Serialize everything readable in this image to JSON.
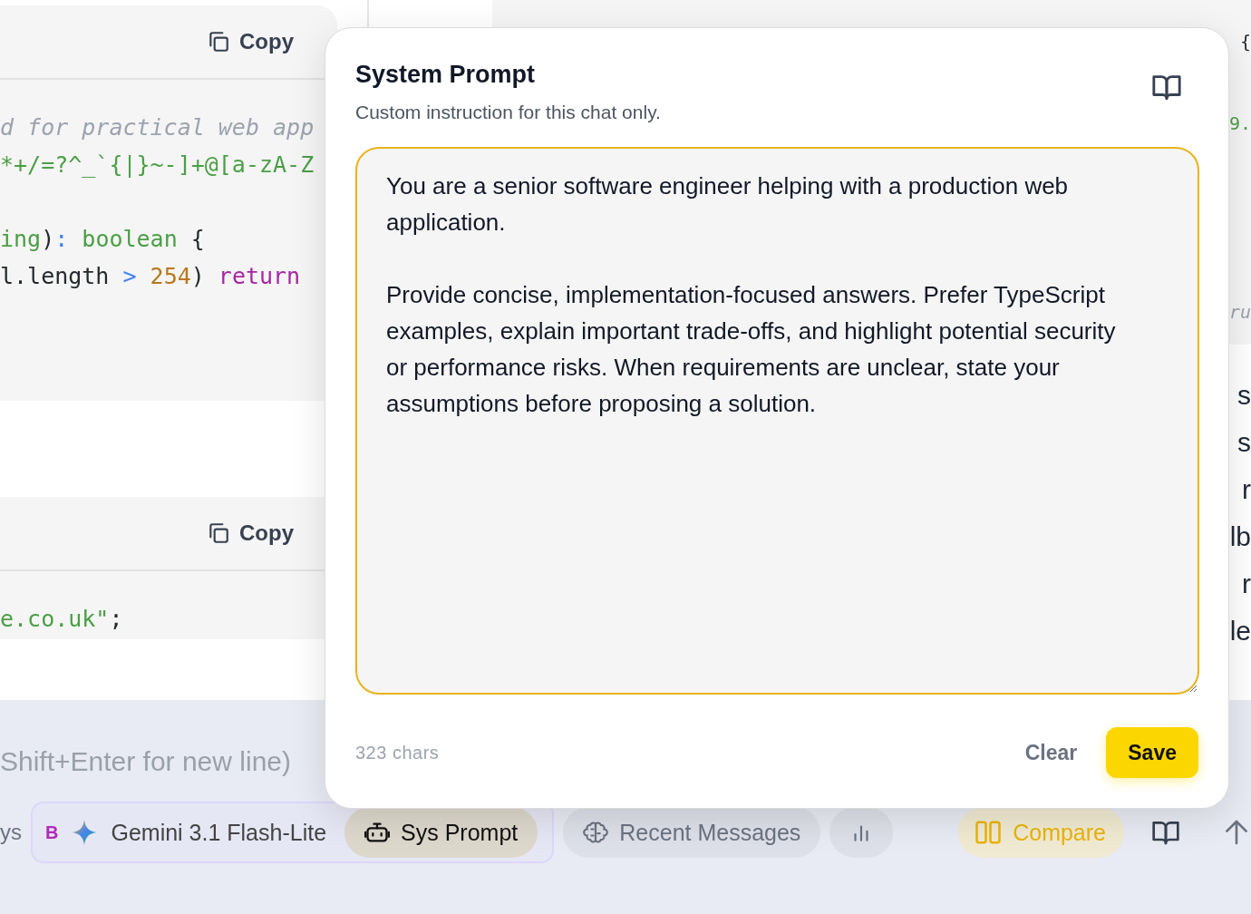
{
  "left_code_blocks": [
    {
      "copy_button": {
        "label": "Copy"
      },
      "groups": [
        [
          {
            "tokens": [
              {
                "kind": "comment",
                "text": "d for practical web app"
              }
            ]
          },
          {
            "tokens": [
              {
                "kind": "string",
                "text": "*+/=?^_`{|}~-]+@[a-zA-Z"
              }
            ]
          }
        ],
        [
          {
            "tokens": [
              {
                "kind": "string",
                "text": "ing"
              },
              {
                "kind": "plain",
                "text": ")"
              },
              {
                "kind": "operator",
                "text": ":"
              },
              {
                "kind": "string",
                "text": " boolean"
              },
              {
                "kind": "plain",
                "text": " {"
              }
            ]
          },
          {
            "tokens": [
              {
                "kind": "plain",
                "text": "l.length "
              },
              {
                "kind": "operator",
                "text": ">"
              },
              {
                "kind": "number",
                "text": " 254"
              },
              {
                "kind": "plain",
                "text": ") "
              },
              {
                "kind": "keyword",
                "text": "return"
              }
            ]
          }
        ]
      ]
    },
    {
      "copy_button": {
        "label": "Copy"
      },
      "groups": [
        [
          {
            "tokens": [
              {
                "kind": "string",
                "text": "e.co.uk\""
              },
              {
                "kind": "plain",
                "text": ";"
              }
            ]
          }
        ]
      ]
    }
  ],
  "right_code_block": {
    "lines": [
      {
        "tokens": [
          {
            "kind": "plain",
            "text": "{"
          }
        ]
      },
      {
        "tokens": [
          {
            "kind": "string",
            "text": "9."
          }
        ]
      },
      {
        "tokens": [
          {
            "kind": "comment",
            "text": "ru"
          }
        ]
      }
    ]
  },
  "right_text_lines": [
    "s",
    "s",
    "r",
    "lb",
    "r",
    "le"
  ],
  "composer": {
    "placeholder": "Shift+Enter for new line)"
  },
  "toolbar": {
    "left_fragment": "ys",
    "model_badge": "B",
    "model_name": "Gemini 3.1 Flash-Lite",
    "pills": [
      {
        "kind": "sys_prompt",
        "label": "Sys Prompt",
        "selected": true
      },
      {
        "kind": "recent",
        "label": "Recent Messages",
        "selected": false
      },
      {
        "kind": "stats",
        "selected": false
      }
    ],
    "compare": {
      "label": "Compare",
      "on": true
    }
  },
  "modal": {
    "title": "System Prompt",
    "subtitle": "Custom instruction for this chat only.",
    "prompt": "You are a senior software engineer helping with a production web application.\n\nProvide concise, implementation-focused answers. Prefer TypeScript examples, explain important trade-offs, and highlight potential security or performance risks. When requirements are unclear, state your assumptions before proposing a solution.",
    "char_count": "323 chars",
    "buttons": [
      {
        "kind": "secondary",
        "label": "Clear"
      },
      {
        "kind": "primary",
        "label": "Save"
      }
    ]
  }
}
